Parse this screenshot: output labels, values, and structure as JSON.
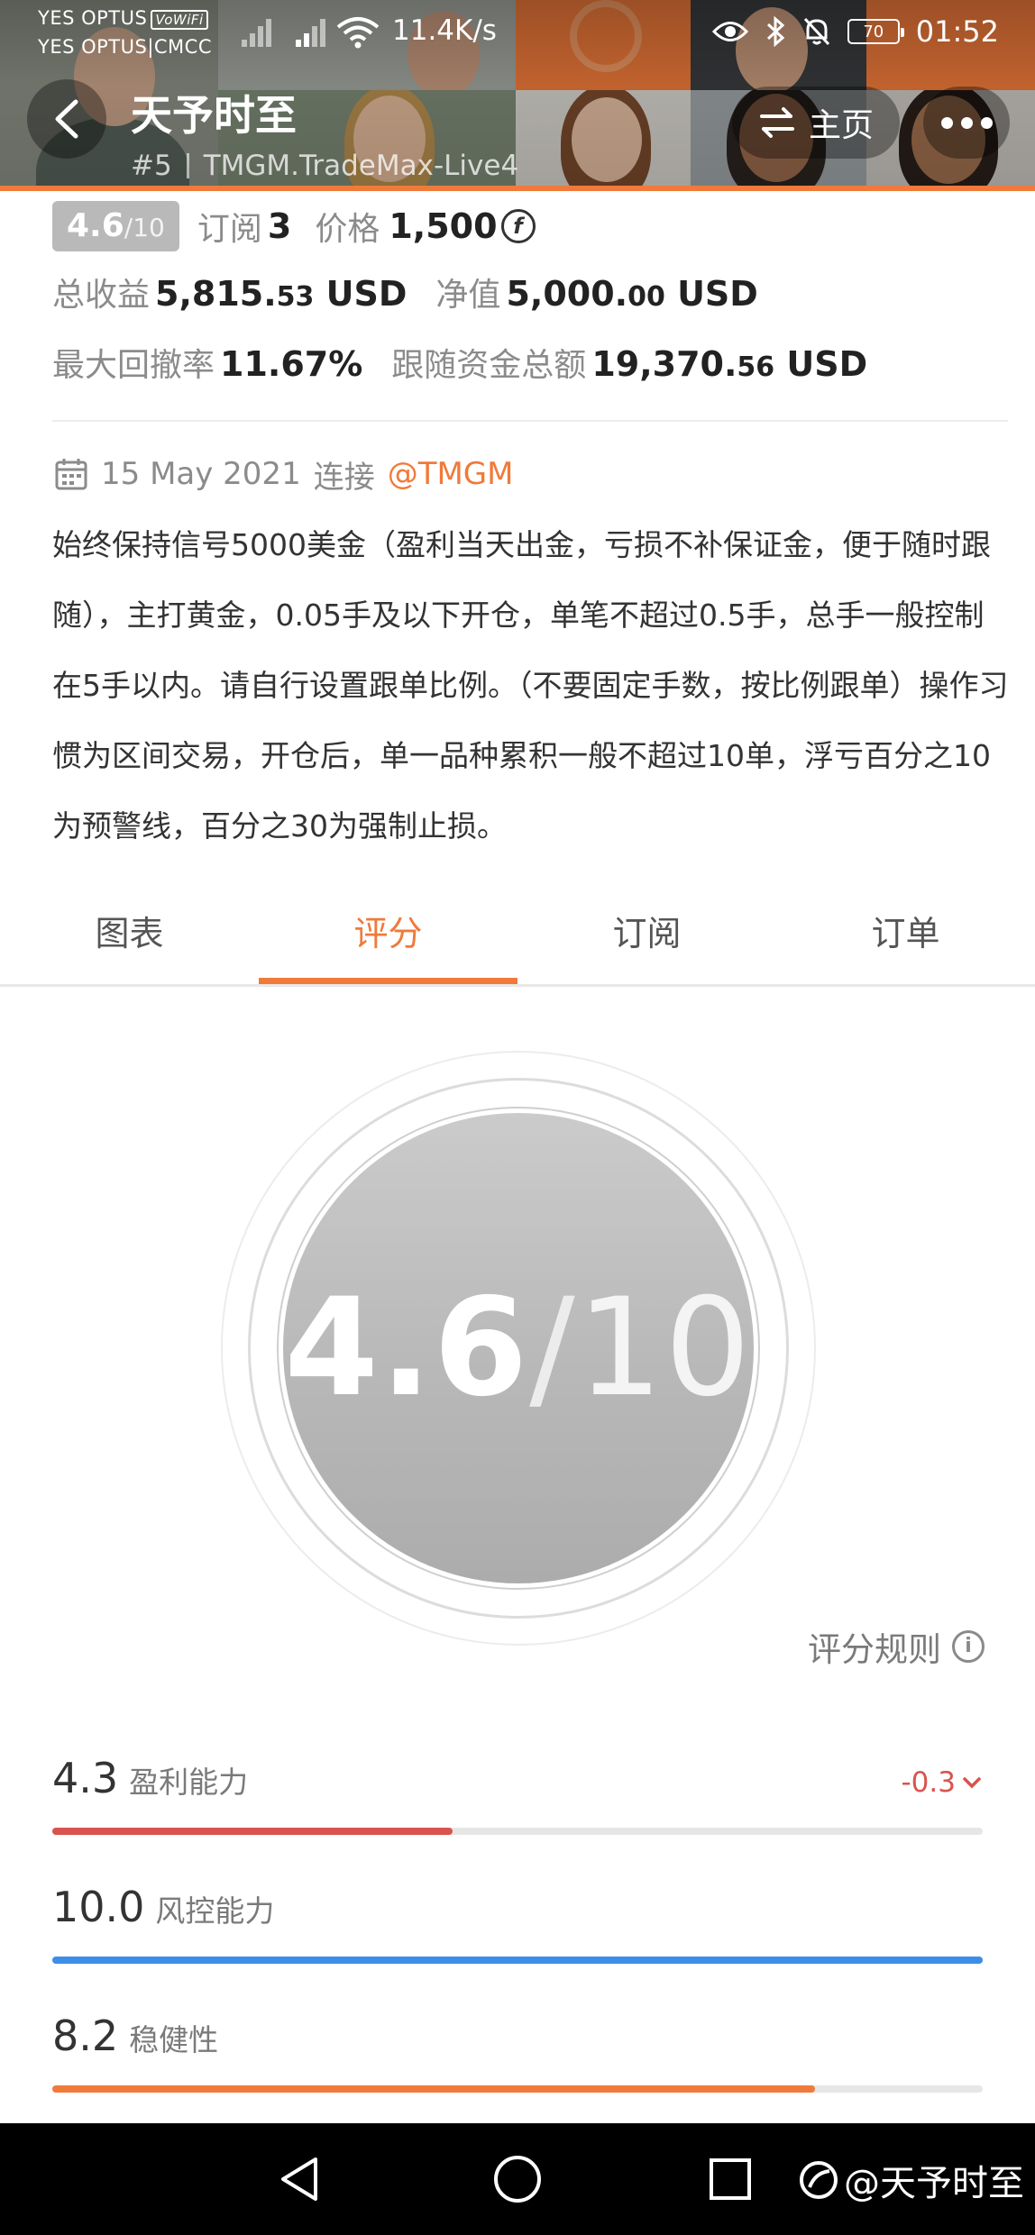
{
  "status_bar": {
    "carrier_1": "YES OPTUS",
    "carrier_1_badge": "VoWiFi",
    "carrier_2": "YES OPTUS|CMCC",
    "speed": "11.4K/s",
    "battery": "70",
    "time": "01:52"
  },
  "header": {
    "trader_name": "天予时至",
    "rank": "#5",
    "account": "TMGM.TradeMax-Live4",
    "home_label": "主页"
  },
  "stats": {
    "score": "4.6",
    "score_of": "/10",
    "subscribe_label": "订阅",
    "subscribe_value": "3",
    "price_label": "价格",
    "price_value": "1,500",
    "coin_symbol": "f",
    "total_profit_label": "总收益",
    "total_profit_int": "5,815.",
    "total_profit_dec": "53",
    "total_profit_unit": "USD",
    "net_label": "净值",
    "net_int": "5,000.",
    "net_dec": "00",
    "net_unit": "USD",
    "max_drawdown_label": "最大回撤率",
    "max_drawdown_value": "11.67%",
    "follow_funds_label": "跟随资金总额",
    "follow_funds_int": "19,370.",
    "follow_funds_dec": "56",
    "follow_funds_unit": "USD"
  },
  "connection": {
    "date": "15 May 2021",
    "connect_label": "连接",
    "broker": "@TMGM"
  },
  "description": "始终保持信号5000美金（盈利当天出金，亏损不补保证金，便于随时跟随），主打黄金，0.05手及以下开仓，单笔不超过0.5手，总手一般控制在5手以内。请自行设置跟单比例。（不要固定手数，按比例跟单）操作习惯为区间交易，开仓后，单一品种累积一般不超过10单，浮亏百分之10为预警线，百分之30为强制止损。",
  "tabs": [
    {
      "label": "图表"
    },
    {
      "label": "评分"
    },
    {
      "label": "订阅"
    },
    {
      "label": "订单"
    }
  ],
  "active_tab": 1,
  "score_circle": {
    "score": "4.6",
    "slash": "/",
    "of": "10"
  },
  "rules_label": "评分规则",
  "metrics": [
    {
      "value": "4.3",
      "label": "盈利能力",
      "delta": "-0.3",
      "level": 0.43,
      "color": "#d9534f"
    },
    {
      "value": "10.0",
      "label": "风控能力",
      "delta": "",
      "level": 1.0,
      "color": "#3d8ee6"
    },
    {
      "value": "8.2",
      "label": "稳健性",
      "delta": "",
      "level": 0.82,
      "color": "#f07a3a"
    }
  ],
  "watermark": "@天予时至",
  "colors": {
    "accent": "#f07a3a",
    "profit_bar": "#d9534f",
    "risk_bar": "#3d8ee6",
    "stability_bar": "#f07a3a"
  }
}
